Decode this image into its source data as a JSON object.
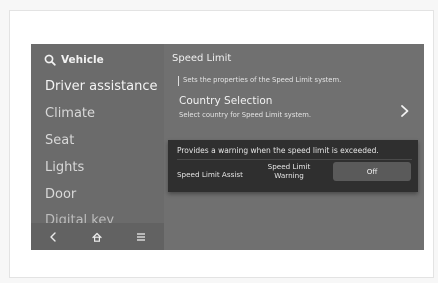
{
  "sidebar": {
    "title": "Vehicle",
    "search_icon": "search-icon",
    "items": [
      {
        "label": "Driver assistance",
        "active": true
      },
      {
        "label": "Climate"
      },
      {
        "label": "Seat"
      },
      {
        "label": "Lights"
      },
      {
        "label": "Door"
      },
      {
        "label": "Digital key"
      }
    ],
    "bottom_nav": [
      {
        "icon": "back-icon"
      },
      {
        "icon": "home-icon"
      },
      {
        "icon": "menu-icon"
      }
    ]
  },
  "main": {
    "title": "Speed Limit",
    "description": "Sets the properties of the Speed Limit system.",
    "country_selection": {
      "title": "Country Selection",
      "subtitle": "Select country for Speed Limit system.",
      "chevron_icon": "chevron-right-icon"
    }
  },
  "popup": {
    "message": "Provides a warning when the speed limit is exceeded.",
    "setting_label": "Speed Limit Assist",
    "option_warning": "Speed Limit Warning",
    "option_off": "Off"
  }
}
